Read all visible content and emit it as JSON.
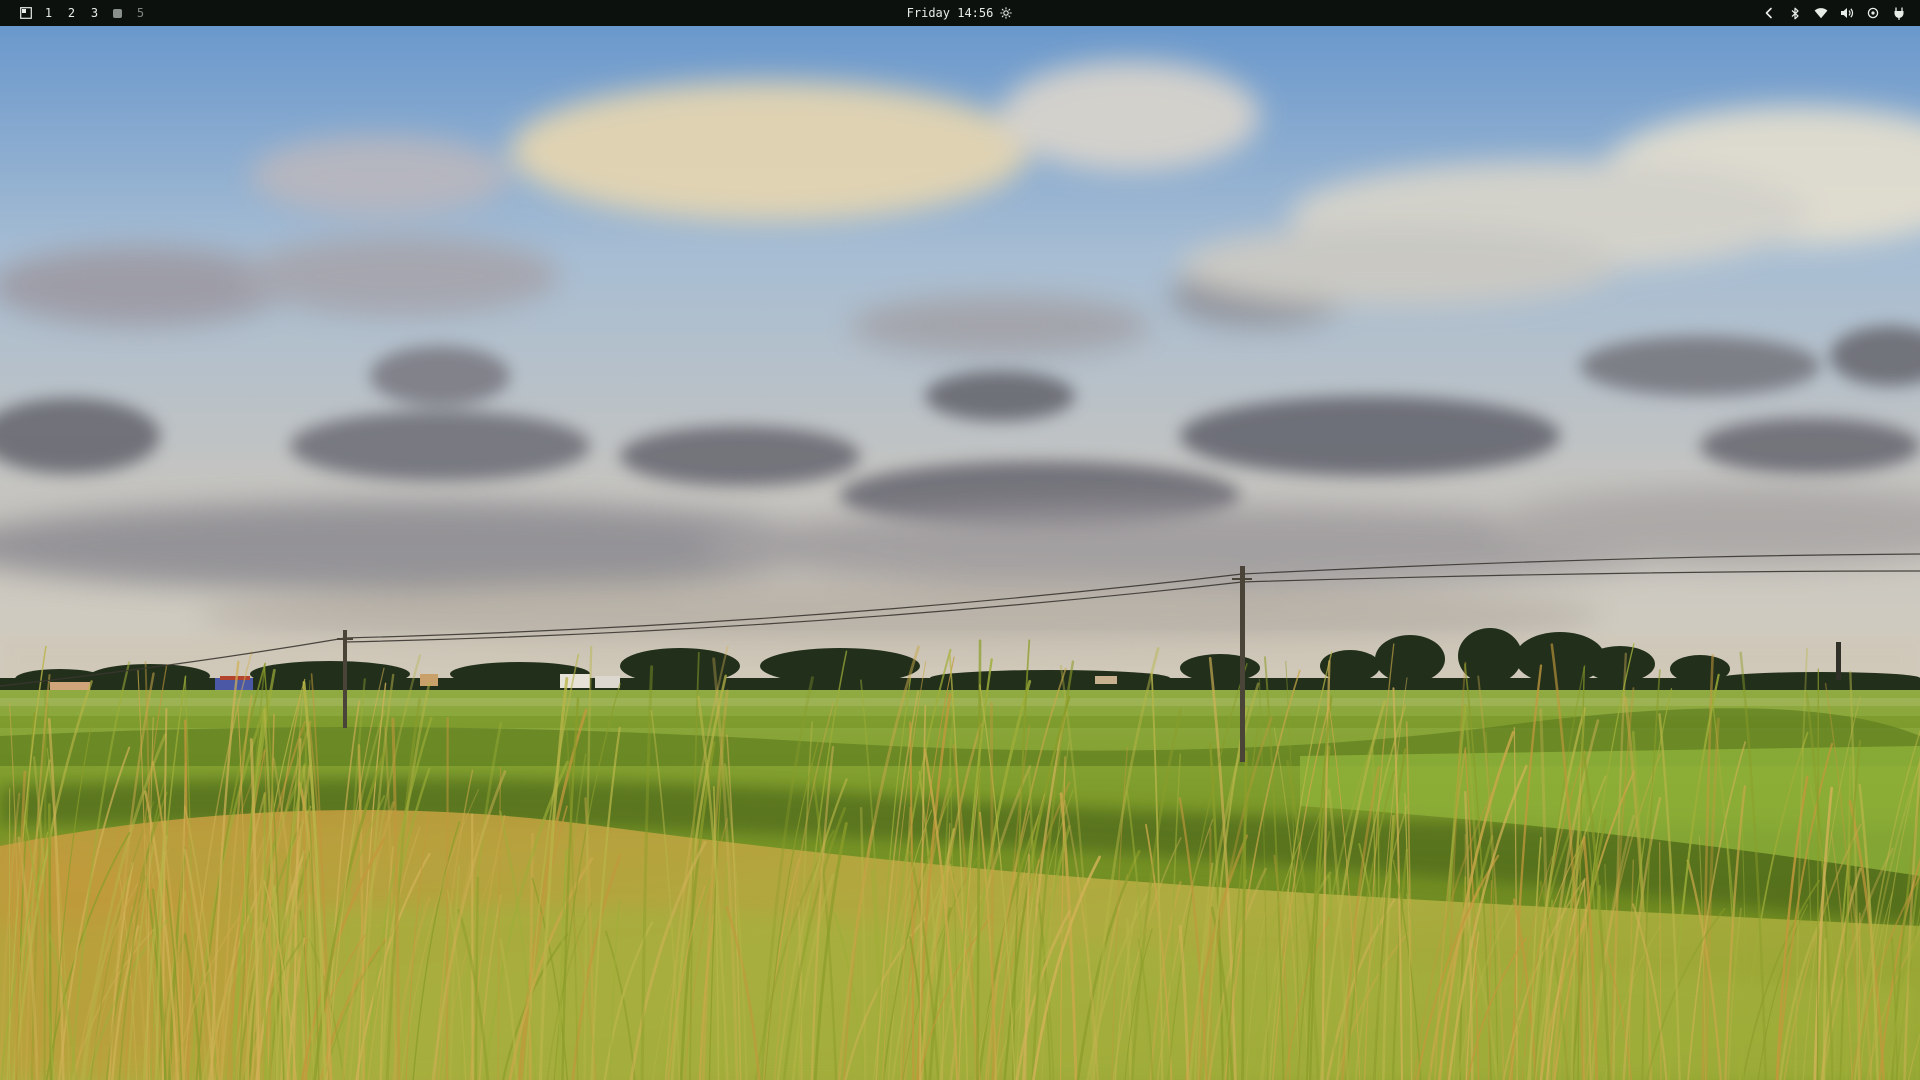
{
  "topbar": {
    "launcher_icon": "layout-icon",
    "workspaces": [
      {
        "label": "1",
        "state": "normal"
      },
      {
        "label": "2",
        "state": "normal"
      },
      {
        "label": "3",
        "state": "normal"
      },
      {
        "label": "",
        "state": "active"
      },
      {
        "label": "5",
        "state": "dim"
      }
    ],
    "clock": "Friday 14:56",
    "clock_icon": "brightness-icon",
    "tray": [
      "chevron-left-icon",
      "bluetooth-icon",
      "wifi-icon",
      "volume-icon",
      "settings-icon",
      "power-icon"
    ]
  },
  "wallpaper": {
    "description_icon": "landscape-wallpaper",
    "colors": {
      "sky_top": "#5e8fc8",
      "sky_mid": "#9fb7cf",
      "cloud_light": "#e6dfd0",
      "cloud_warm": "#e9d3a8",
      "cloud_dark": "#6e7178",
      "horizon": "#c9c3b8",
      "tree_line": "#1f2a19",
      "grass_far": "#8aa83c",
      "grass_mid": "#6f9226",
      "grass_near": "#9aa832",
      "grass_gold": "#c9a94a"
    }
  }
}
